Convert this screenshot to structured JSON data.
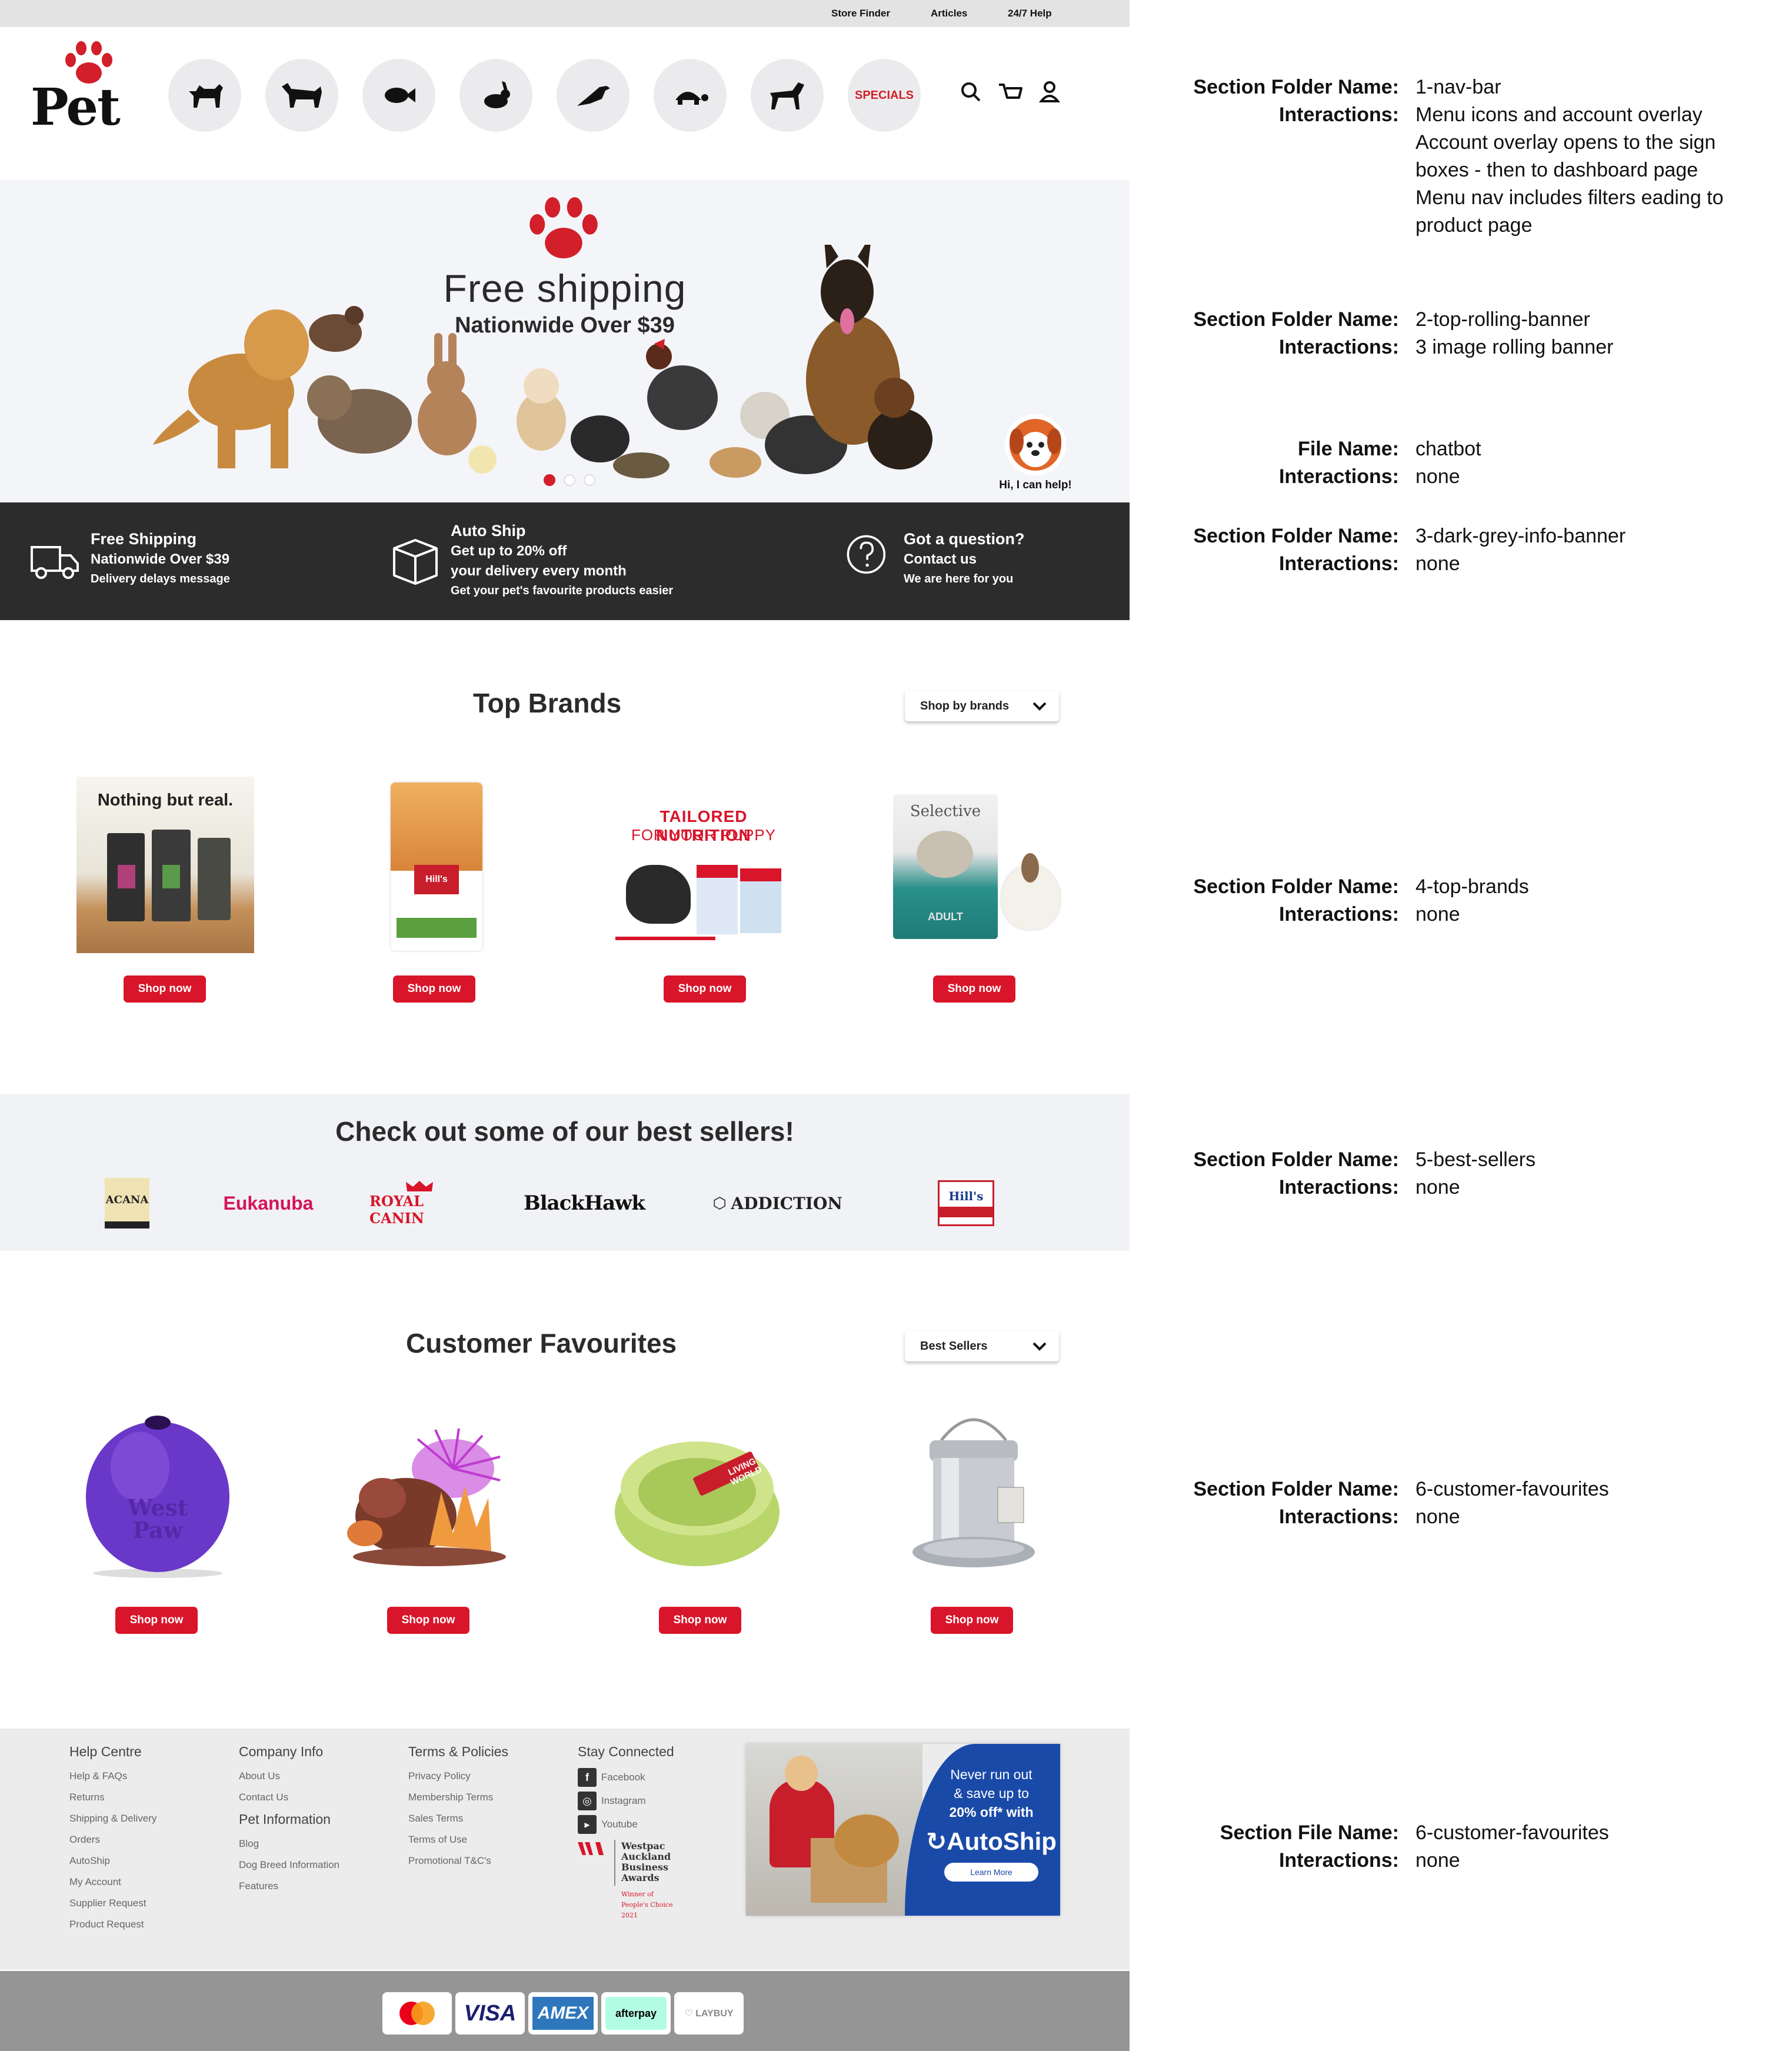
{
  "util_bar": {
    "store_finder": "Store Finder",
    "articles": "Articles",
    "help": "24/7 Help"
  },
  "logo": {
    "word": "Pet"
  },
  "nav": {
    "categories": [
      "dog",
      "cat",
      "fish",
      "rabbit",
      "bird",
      "turtle",
      "horse"
    ],
    "specials": "SPECIALS",
    "tools": [
      "search-icon",
      "cart-icon",
      "account-icon"
    ]
  },
  "hero": {
    "title": "Free shipping",
    "subtitle": "Nationwide Over $39",
    "slides": 3,
    "active_slide": 1,
    "chatbot_label": "Hi, I can help!"
  },
  "info_banner": {
    "shipping": {
      "l1": "Free Shipping",
      "l2": "Nationwide Over $39",
      "l3": "Delivery delays message"
    },
    "autoship": {
      "l1": "Auto Ship",
      "l2": "Get up to 20% off",
      "l2b": "your delivery every month",
      "l3": "Get your pet's favourite products easier"
    },
    "question": {
      "l1": "Got a question?",
      "l2": "Contact us",
      "l3": "We are here for you"
    }
  },
  "top_brands": {
    "title": "Top Brands",
    "dropdown": "Shop by brands",
    "cards": [
      {
        "text": "Nothing but real.",
        "button": "Shop now"
      },
      {
        "text": "Hill's",
        "button": "Shop now"
      },
      {
        "text": "TAILORED NUTRITION",
        "text2": "FOR YOUR PUPPY",
        "button": "Shop now"
      },
      {
        "text": "Selective",
        "text2": "ADULT",
        "button": "Shop now"
      }
    ]
  },
  "best_sellers": {
    "title": "Check out some of our best sellers!",
    "brands": [
      "ACANA",
      "Eukanuba",
      "ROYAL CANIN",
      "BlackHawk",
      "ADDICTION",
      "Hill's"
    ]
  },
  "customer_favourites": {
    "title": "Customer Favourites",
    "dropdown": "Best Sellers",
    "buttons": [
      "Shop now",
      "Shop now",
      "Shop now",
      "Shop now"
    ],
    "ball_text": "West Paw",
    "bowl_text": "LIVING WORLD"
  },
  "footer": {
    "help": {
      "title": "Help Centre",
      "links": [
        "Help & FAQs",
        "Returns",
        "Shipping & Delivery",
        "Orders",
        "AutoShip",
        "My Account",
        "Supplier Request",
        "Product Request"
      ]
    },
    "company": {
      "title": "Company Info",
      "links": [
        "About Us",
        "Contact Us"
      ]
    },
    "pet_info": {
      "title": "Pet Information",
      "links": [
        "Blog",
        "Dog Breed Information",
        "Features"
      ]
    },
    "terms": {
      "title": "Terms & Policies",
      "links": [
        "Privacy Policy",
        "Membership Terms",
        "Sales Terms",
        "Terms of Use",
        "Promotional T&C's"
      ]
    },
    "social": {
      "title": "Stay Connected",
      "links": [
        "Facebook",
        "Instagram",
        "Youtube"
      ]
    },
    "award": {
      "line1": "Westpac Auckland",
      "line2": "Business Awards",
      "line3": "Winner of People's Choice 2021"
    },
    "promo": {
      "line1": "Never run out",
      "line2": "& save up to",
      "line3": "20% off* with",
      "brand": "AutoShip",
      "button": "Learn More"
    }
  },
  "payments": [
    "VISA",
    "AMEX",
    "afterpay",
    "LAYBUY"
  ],
  "annotations": [
    {
      "label": "Section Folder Name:",
      "value": "1-nav-bar"
    },
    {
      "label": "Interactions:",
      "value": "Menu icons and account overlay",
      "extra": [
        "Account overlay opens to the sign",
        "boxes - then to dashboard page",
        "Menu nav includes filters eading to",
        "product page"
      ]
    },
    {
      "label": "Section Folder Name:",
      "value": "2-top-rolling-banner"
    },
    {
      "label": "Interactions:",
      "value": "3 image rolling banner"
    },
    {
      "label": "File Name:",
      "value": "chatbot"
    },
    {
      "label": "Interactions:",
      "value": "none"
    },
    {
      "label": "Section Folder Name:",
      "value": "3-dark-grey-info-banner"
    },
    {
      "label": "Interactions:",
      "value": "none"
    },
    {
      "label": "Section Folder Name:",
      "value": "4-top-brands"
    },
    {
      "label": "Interactions:",
      "value": "none"
    },
    {
      "label": "Section Folder Name:",
      "value": "5-best-sellers"
    },
    {
      "label": "Interactions:",
      "value": "none"
    },
    {
      "label": "Section Folder Name:",
      "value": "6-customer-favourites"
    },
    {
      "label": "Interactions:",
      "value": "none"
    },
    {
      "label": "Section File Name:",
      "value": "6-customer-favourites"
    },
    {
      "label": "Interactions:",
      "value": "none"
    }
  ]
}
